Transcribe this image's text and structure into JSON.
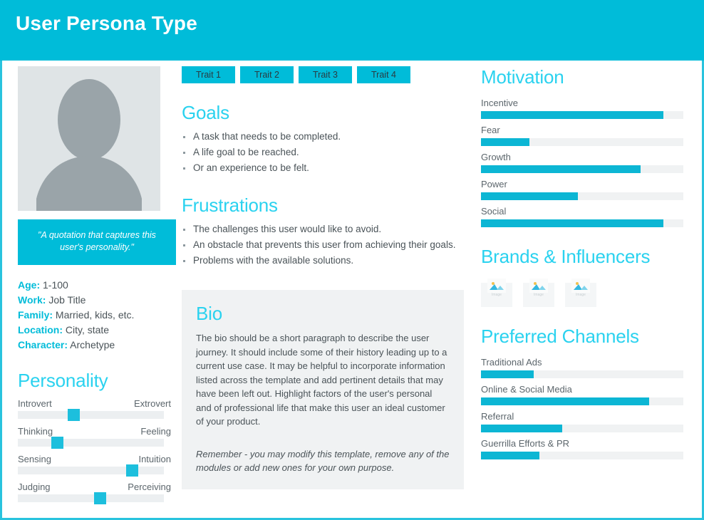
{
  "header": {
    "title": "User Persona Type"
  },
  "avatar": {
    "icon": "person-silhouette-icon",
    "alt": "persona photo placeholder"
  },
  "quote": {
    "text": "\"A quotation that captures this user's personality.\""
  },
  "details": [
    {
      "label": "Age:",
      "value": "1-100"
    },
    {
      "label": "Work:",
      "value": "Job Title"
    },
    {
      "label": "Family:",
      "value": "Married, kids, etc."
    },
    {
      "label": "Location:",
      "value": "City, state"
    },
    {
      "label": "Character:",
      "value": "Archetype"
    }
  ],
  "personality": {
    "heading": "Personality",
    "sliders": [
      {
        "left": "Introvert",
        "right": "Extrovert",
        "value": 38
      },
      {
        "left": "Thinking",
        "right": "Feeling",
        "value": 27
      },
      {
        "left": "Sensing",
        "right": "Intuition",
        "value": 78
      },
      {
        "left": "Judging",
        "right": "Perceiving",
        "value": 56
      }
    ]
  },
  "traits": [
    {
      "label": "Trait 1"
    },
    {
      "label": "Trait 2"
    },
    {
      "label": "Trait 3"
    },
    {
      "label": "Trait 4"
    }
  ],
  "goals": {
    "heading": "Goals",
    "items": [
      "A task that needs to be completed.",
      "A life goal to be reached.",
      "Or an experience to be felt."
    ]
  },
  "frustrations": {
    "heading": "Frustrations",
    "items": [
      "The challenges this user would like to avoid.",
      "An obstacle that prevents this user from achieving their goals.",
      "Problems with the available solutions."
    ]
  },
  "bio": {
    "heading": "Bio",
    "text": "The bio should be a short paragraph to describe the user journey. It should include some of their history leading up to a current use case. It may be helpful to incorporate information listed across the template and add pertinent details that may have been left out. Highlight factors of the user's personal and of professional life that make this user an ideal customer of your product.",
    "note": "Remember - you may modify this template, remove any of the modules or add new ones for your own purpose."
  },
  "motivation": {
    "heading": "Motivation",
    "bars": [
      {
        "label": "Incentive",
        "value": 90
      },
      {
        "label": "Fear",
        "value": 24
      },
      {
        "label": "Growth",
        "value": 79
      },
      {
        "label": "Power",
        "value": 48
      },
      {
        "label": "Social",
        "value": 90
      }
    ]
  },
  "brands": {
    "heading": "Brands & Influencers",
    "placeholders": [
      {
        "caption": "Image",
        "icon": "image-placeholder-icon"
      },
      {
        "caption": "Image",
        "icon": "image-placeholder-icon"
      },
      {
        "caption": "Image",
        "icon": "image-placeholder-icon"
      }
    ]
  },
  "channels": {
    "heading": "Preferred Channels",
    "bars": [
      {
        "label": "Traditional Ads",
        "value": 26
      },
      {
        "label": "Online & Social Media",
        "value": 83
      },
      {
        "label": "Referral",
        "value": 40
      },
      {
        "label": "Guerrilla Efforts & PR",
        "value": 29
      }
    ]
  },
  "colors": {
    "brand_cyan": "#00bcd9",
    "heading_cyan": "#2ad2ef",
    "border_cyan": "#29c3de",
    "bar_fill": "#0cb6d4",
    "track_gray": "#f0f2f3",
    "panel_gray": "#f0f2f3",
    "text_gray": "#4a5358"
  }
}
